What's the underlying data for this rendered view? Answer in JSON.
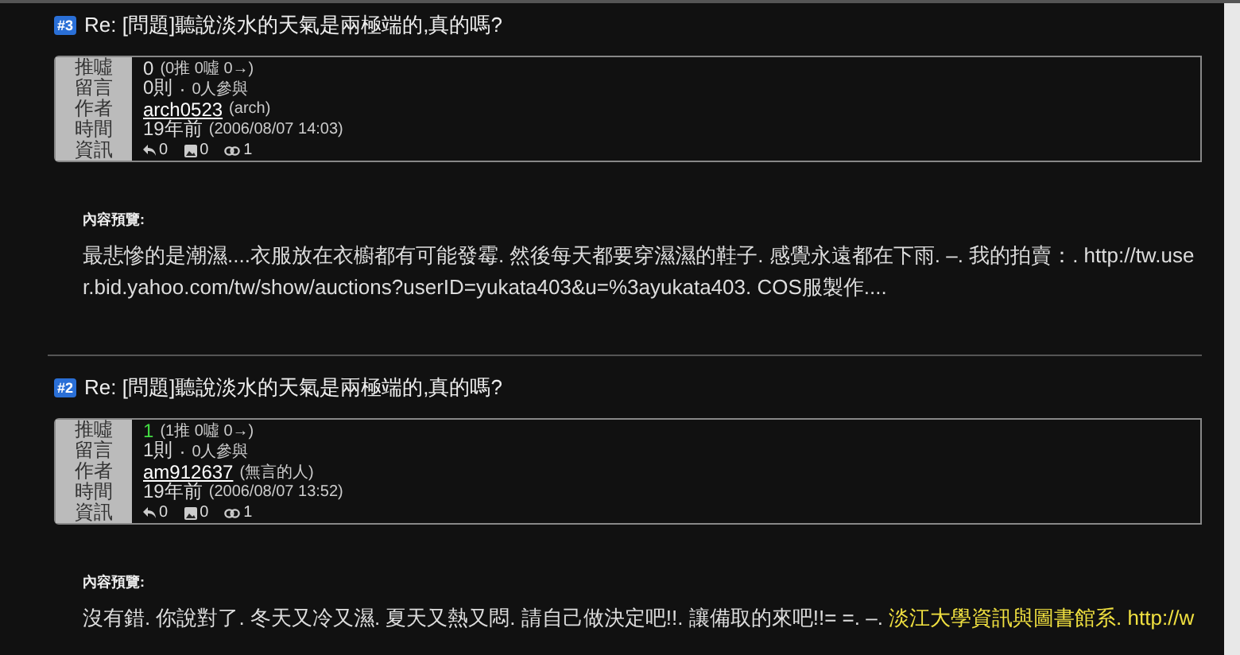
{
  "posts": [
    {
      "number": "#3",
      "title": "Re: [問題]聽說淡水的天氣是兩極端的,真的嗎?",
      "labels": [
        "推噓",
        "留言",
        "作者",
        "時間",
        "資訊"
      ],
      "score": "0",
      "score_positive": false,
      "score_detail": "(0推 0噓 0→)",
      "comments": "0則",
      "separator": "·",
      "participants": "0人參與",
      "author": "arch0523",
      "nickname": "(arch)",
      "age": "19年前",
      "date": "(2006/08/07 14:03)",
      "stats": [
        {
          "kind": "reply",
          "count": "0"
        },
        {
          "kind": "image",
          "count": "0"
        },
        {
          "kind": "link",
          "count": "1"
        }
      ],
      "preview_label": "內容預覽:",
      "preview": [
        {
          "text": "最悲慘的是潮濕....衣服放在衣櫥都有可能發霉. 然後每天都要穿濕濕的鞋子. 感覺永遠都在下雨. –. 我的拍賣：. http://tw.user.bid.yahoo.com/tw/show/auctions?userID=yukata403&u=%3ayukata403. COS服製作....",
          "highlight": false
        }
      ]
    },
    {
      "number": "#2",
      "title": "Re: [問題]聽說淡水的天氣是兩極端的,真的嗎?",
      "labels": [
        "推噓",
        "留言",
        "作者",
        "時間",
        "資訊"
      ],
      "score": "1",
      "score_positive": true,
      "score_detail": "(1推 0噓 0→)",
      "comments": "1則",
      "separator": "·",
      "participants": "0人參與",
      "author": "am912637",
      "nickname": "(無言的人)",
      "age": "19年前",
      "date": "(2006/08/07 13:52)",
      "stats": [
        {
          "kind": "reply",
          "count": "0"
        },
        {
          "kind": "image",
          "count": "0"
        },
        {
          "kind": "link",
          "count": "1"
        }
      ],
      "preview_label": "內容預覽:",
      "preview": [
        {
          "text": "沒有錯. 你說對了. 冬天又冷又濕. 夏天又熱又悶. 請自己做決定吧!!. 讓備取的來吧!!= =. –. ",
          "highlight": false
        },
        {
          "text": "淡江大學資訊與圖書館系. http://w",
          "highlight": true
        }
      ]
    }
  ]
}
